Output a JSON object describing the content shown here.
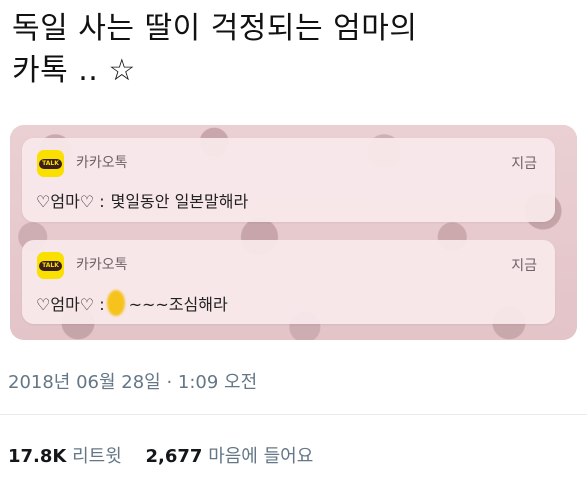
{
  "tweet": {
    "line1": "독일 사는 딸이 걱정되는 엄마의",
    "line2": "카톡 .. ☆"
  },
  "notifications": [
    {
      "app_icon_text": "TALK",
      "app_name": "카카오톡",
      "time": "지금",
      "sender": "♡엄마♡ :",
      "message": "몇일동안 일본말해라"
    },
    {
      "app_icon_text": "TALK",
      "app_name": "카카오톡",
      "time": "지금",
      "sender": "♡엄마♡ :",
      "message": "~~~조심해라"
    }
  ],
  "timestamp": "2018년 06월 28일 · 1:09 오전",
  "stats": {
    "retweets_count": "17.8K",
    "retweets_label": "리트윗",
    "likes_count": "2,677",
    "likes_label": "마음에 들어요"
  },
  "colors": {
    "kakao_yellow": "#f9e000",
    "kakao_brown": "#3b1e1e",
    "meta_gray": "#657786",
    "notif_bg": "#f9e9eb"
  }
}
